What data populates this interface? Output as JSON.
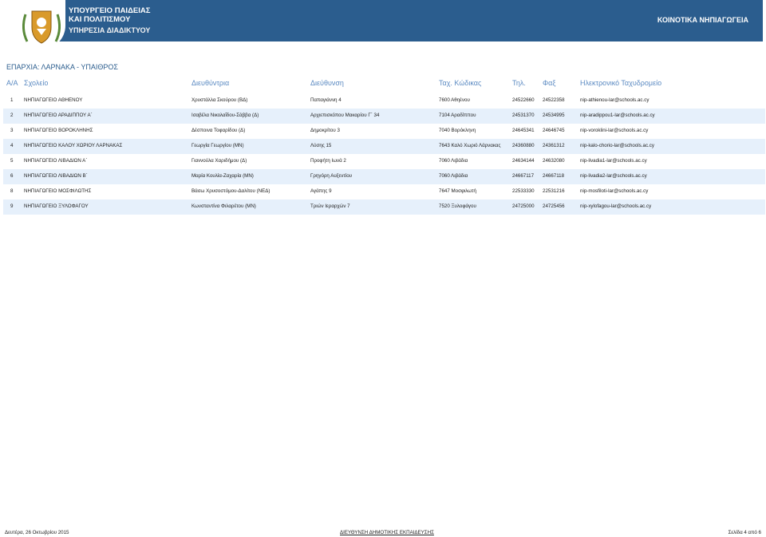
{
  "header": {
    "ministry_line1": "ΥΠΟΥΡΓΕΙΟ ΠΑΙΔΕΙΑΣ",
    "ministry_line2": "ΚΑΙ ΠΟΛΙΤΙΣΜΟΥ",
    "service": "ΥΠΗΡΕΣΙΑ ΔΙΑΔΙΚΤΥΟΥ",
    "right_title": "ΚΟΙΝΟΤΙΚΑ ΝΗΠΙΑΓΩΓΕΙΑ",
    "crest_icon": "cyprus-crest-icon",
    "brand_color": "#2b5d8e",
    "crest_color": "#d99a2b"
  },
  "province_title": "ΕΠΑΡΧΙΑ:  ΛΑΡΝΑΚΑ - ΥΠΑΙΘΡΟΣ",
  "columns": {
    "num": "Α/Α",
    "school": "Σχολείο",
    "director": "Διευθύντρια",
    "address": "Διεύθυνση",
    "postcode": "Ταχ. Κώδικας",
    "tel": "Τηλ.",
    "fax": "Φαξ",
    "email": "Ηλεκτρονικό Ταχυδρομείο"
  },
  "rows": [
    {
      "num": "1",
      "school": "ΝΗΠΙΑΓΩΓΕΙΟ ΑΘΗΕΝΟΥ",
      "director": "Χρυστάλλα Σκούρου (ΒΔ)",
      "address": "Παπαγιάννη 4",
      "postcode": "7600 Αθηένου",
      "tel": "24522660",
      "fax": "24522358",
      "email": "nip-athienou-lar@schools.ac.cy"
    },
    {
      "num": "2",
      "school": "ΝΗΠΙΑΓΩΓΕΙΟ ΑΡΑΔΙΠΠΟΥ Α΄",
      "director": "Ισαβέλα Νικολαΐδου-Σάββα (Δ)",
      "address": "Αρχιεπισκόπου Μακαρίου Γ΄ 34",
      "postcode": "7104 Αραδίππου",
      "tel": "24531370",
      "fax": "24534995",
      "email": "nip-aradippou1-lar@schools.ac.cy"
    },
    {
      "num": "3",
      "school": "ΝΗΠΙΑΓΩΓΕΙΟ ΒΟΡΟΚΛΗΝΗΣ",
      "director": "Δέσποινα Τοφαρίδου (Δ)",
      "address": "Δημοκρίτου 3",
      "postcode": "7040 Βορόκληνη",
      "tel": "24645341",
      "fax": "24646745",
      "email": "nip-voroklini-lar@schools.ac.cy"
    },
    {
      "num": "4",
      "school": "ΝΗΠΙΑΓΩΓΕΙΟ ΚΑΛΟΥ ΧΩΡΙΟΥ ΛΑΡΝΑΚΑΣ",
      "director": "Γεωργία Γεωργίου (ΜΝ)",
      "address": "Λύσης 15",
      "postcode": "7643 Καλό Χωριό Λάρνακας",
      "tel": "24360880",
      "fax": "24361312",
      "email": "nip-kalo-chorio-lar@schools.ac.cy"
    },
    {
      "num": "5",
      "school": "ΝΗΠΙΑΓΩΓΕΙΟ ΛΙΒΑΔΙΩΝ Α΄",
      "director": "Γιαννούλα Χαριδήμου (Δ)",
      "address": "Προφήτη Ιωνά 2",
      "postcode": "7060 Λιβάδια",
      "tel": "24634144",
      "fax": "24632080",
      "email": "nip-livadia1-lar@schools.ac.cy"
    },
    {
      "num": "6",
      "school": "ΝΗΠΙΑΓΩΓΕΙΟ ΛΙΒΑΔΙΩΝ Β΄",
      "director": "Μαρία Κουλία-Ζαχαρία  (ΜΝ)",
      "address": "Γρηγόρη Αυξεντίου",
      "postcode": "7060 Λιβάδια",
      "tel": "24667117",
      "fax": "24667118",
      "email": "nip-livadia2-lar@schools.ac.cy"
    },
    {
      "num": "8",
      "school": "ΝΗΠΙΑΓΩΓΕΙΟ ΜΟΣΦΙΛΩΤΗΣ",
      "director": "Βάσω Χρυσοστόμου-Δαλίτου (ΝΕΔ)",
      "address": "Αγάπης 9",
      "postcode": "7647 Μοσφιλωτή",
      "tel": "22533330",
      "fax": "22531216",
      "email": "nip-mosfiloti-lar@schools.ac.cy"
    },
    {
      "num": "9",
      "school": "ΝΗΠΙΑΓΩΓΕΙΟ ΞΥΛΟΦΑΓΟΥ",
      "director": "Κωνσταντίνα Φιλαρέτου (ΜΝ)",
      "address": "Τριών Ιεραρχών 7",
      "postcode": "7520 Ξυλοφάγου",
      "tel": "24725000",
      "fax": "24725456",
      "email": "nip-xylofagou-lar@schools.ac.cy"
    }
  ],
  "footer": {
    "date": "Δευτέρα, 26 Οκτωβρίου 2015",
    "department": "ΔΙΕΥΘΥΝΣΗ ΔΗΜΟΤΙΚΗΣ ΕΚΠΑΙΔΕΥΣΗΣ",
    "page": "Σελίδα 4 από 6"
  }
}
